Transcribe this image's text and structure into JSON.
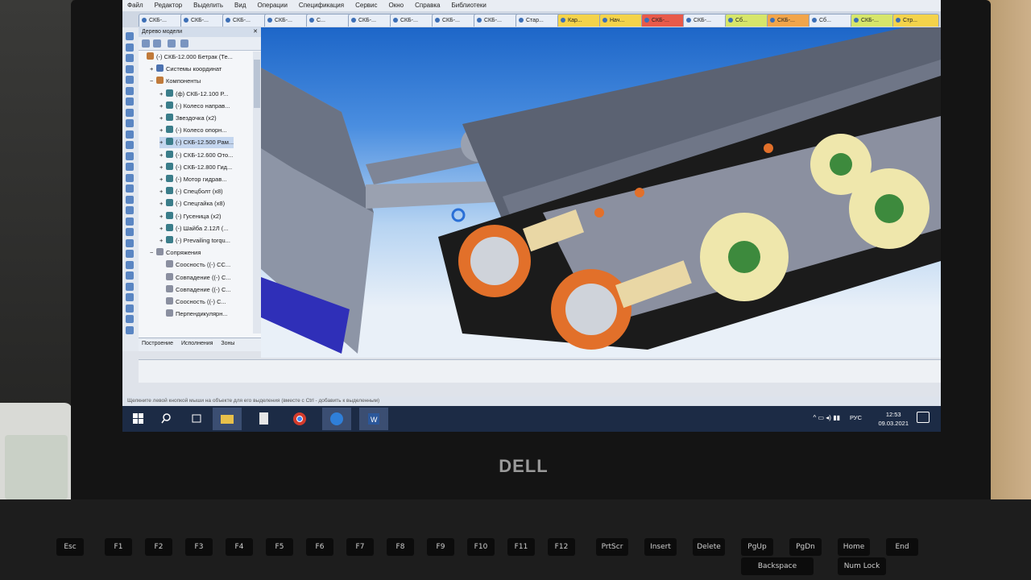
{
  "menu": [
    "Файл",
    "Редактор",
    "Выделить",
    "Вид",
    "Операции",
    "Спецификация",
    "Сервис",
    "Окно",
    "Справка",
    "Библиотеки"
  ],
  "document_tabs": [
    "СКБ-...",
    "СКБ-...",
    "СКБ-...",
    "СКБ-...",
    "С...",
    "СКБ-...",
    "СКБ-...",
    "СКБ-...",
    "СКБ-...",
    "Стар...",
    "Кар...",
    "Нач...",
    "СКБ-...",
    "СКБ-...",
    "Сб...",
    "СКБ-...",
    "Сб...",
    "СКБ-...",
    "Стр..."
  ],
  "tree": {
    "title": "Дерево модели",
    "close_glyph": "✕",
    "items": [
      {
        "label": "(-) СКБ-12.000 Бетрак (Те...",
        "icon": "asm",
        "level": 0,
        "expand": ""
      },
      {
        "label": "Системы координат",
        "icon": "sys",
        "level": 1,
        "expand": "+"
      },
      {
        "label": "Компоненты",
        "icon": "asm",
        "level": 1,
        "expand": "−"
      },
      {
        "label": "(ф) СКБ-12.100   Р...",
        "icon": "part",
        "level": 2,
        "expand": "+"
      },
      {
        "label": "(-) Колесо направ...",
        "icon": "part",
        "level": 2,
        "expand": "+"
      },
      {
        "label": "Звездочка (x2)",
        "icon": "part",
        "level": 2,
        "expand": "+"
      },
      {
        "label": "(-) Колесо опорн...",
        "icon": "part",
        "level": 2,
        "expand": "+"
      },
      {
        "label": "(-) СКБ-12.500 Рам...",
        "icon": "part",
        "level": 2,
        "expand": "+"
      },
      {
        "label": "(-) СКБ-12.600 Ото...",
        "icon": "part",
        "level": 2,
        "expand": "+"
      },
      {
        "label": "(-) СКБ-12.800 Гид...",
        "icon": "part",
        "level": 2,
        "expand": "+"
      },
      {
        "label": "(-) Мотор гидрав...",
        "icon": "part",
        "level": 2,
        "expand": "+"
      },
      {
        "label": "(-) Спецболт (x8)",
        "icon": "part",
        "level": 2,
        "expand": "+"
      },
      {
        "label": "(-) Спецгайка (x8)",
        "icon": "part",
        "level": 2,
        "expand": "+"
      },
      {
        "label": "(-) Гусеница (x2)",
        "icon": "part",
        "level": 2,
        "expand": "+"
      },
      {
        "label": "(-) Шайба 2.12Л (...",
        "icon": "part",
        "level": 2,
        "expand": "+"
      },
      {
        "label": "(-) Prevailing torqu...",
        "icon": "part",
        "level": 2,
        "expand": "+"
      },
      {
        "label": "Сопряжения",
        "icon": "mate",
        "level": 1,
        "expand": "−"
      },
      {
        "label": "Соосность ((-) СС...",
        "icon": "mate",
        "level": 2,
        "expand": ""
      },
      {
        "label": "Совпадение ((-) С...",
        "icon": "mate",
        "level": 2,
        "expand": ""
      },
      {
        "label": "Совпадение ((-) С...",
        "icon": "mate",
        "level": 2,
        "expand": ""
      },
      {
        "label": "Соосность ((-) С...",
        "icon": "mate",
        "level": 2,
        "expand": ""
      },
      {
        "label": "Перпендикулярн...",
        "icon": "mate",
        "level": 2,
        "expand": ""
      }
    ],
    "bottom_tabs": [
      "Построение",
      "Исполнения",
      "Зоны"
    ]
  },
  "status_text": "Щелкните левой кнопкой мыши на объекте для его выделения (вместе с Ctrl - добавить к выделенным)",
  "taskbar": {
    "lang": "РУС",
    "time": "12:53",
    "date": "09.03.2021",
    "tray": "^ ▭ ◂) ▮▮"
  },
  "laptop_brand": "DELL",
  "keyboard": [
    "Esc",
    "F1",
    "F2",
    "F3",
    "F4",
    "F5",
    "F6",
    "F7",
    "F8",
    "F9",
    "F10",
    "F11",
    "F12",
    "PrtScr",
    "Insert",
    "Delete",
    "PgUp",
    "PgDn",
    "Home",
    "End",
    "Backspace",
    "Num Lock"
  ],
  "colors": {
    "accent": "#1c2b45",
    "viewport_sky": "#4a8ee0",
    "wheel": "#f0eab0",
    "sprocket": "#e2702a",
    "blade_blue": "#2f2fb8"
  }
}
